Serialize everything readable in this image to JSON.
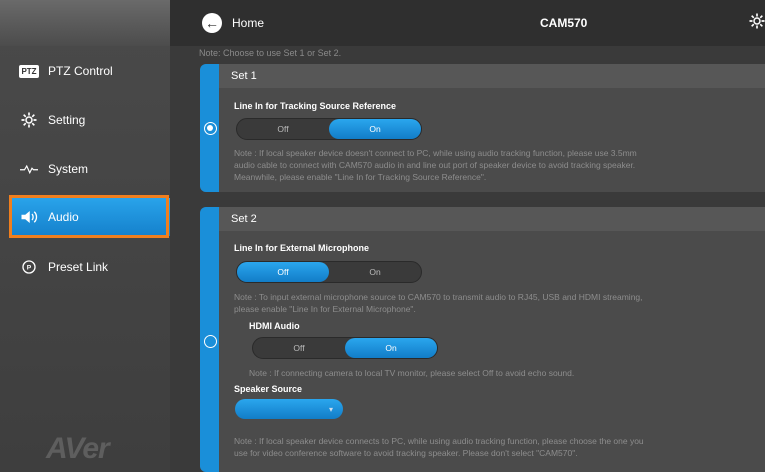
{
  "topbar": {
    "home_label": "Home",
    "camera_title": "CAM570"
  },
  "sidebar": {
    "items": [
      {
        "label": "PTZ Control",
        "icon": "ptz-icon"
      },
      {
        "label": "Setting",
        "icon": "gear-icon"
      },
      {
        "label": "System",
        "icon": "pulse-icon"
      },
      {
        "label": "Audio",
        "icon": "speaker-icon"
      },
      {
        "label": "Preset Link",
        "icon": "preset-icon"
      }
    ],
    "active": "Audio",
    "logo": "AVer"
  },
  "main": {
    "top_note": "Note: Choose to use Set 1 or Set 2.",
    "set1": {
      "title": "Set 1",
      "selected": true,
      "option_label": "Line In for Tracking Source Reference",
      "toggle": {
        "off": "Off",
        "on": "On",
        "value": "On"
      },
      "note_line1": "Note : If local speaker device doesn't connect to PC, while using audio tracking function, please use 3.5mm",
      "note_line2": "audio cable to connect with CAM570 audio in and line out port of speaker device to avoid tracking speaker.",
      "note_line3": "Meanwhile, please enable \"Line In for Tracking Source Reference\"."
    },
    "set2": {
      "title": "Set 2",
      "selected": false,
      "option_label": "Line In for External Microphone",
      "toggle": {
        "off": "Off",
        "on": "On",
        "value": "Off"
      },
      "note_line1": "Note : To input external microphone source to CAM570 to transmit audio to RJ45, USB and HDMI streaming,",
      "note_line2": "please enable \"Line In for External Microphone\".",
      "hdmi_label": "HDMI Audio",
      "hdmi_toggle": {
        "off": "Off",
        "on": "On",
        "value": "On"
      },
      "hdmi_note": "Note : If connecting camera to local TV monitor, please select Off to avoid echo sound.",
      "speaker_label": "Speaker Source",
      "speaker_note_line1": "Note : If local speaker device connects to PC, while using audio tracking function, please choose the one you",
      "speaker_note_line2": "use for video conference software to avoid tracking speaker. Please don't select \"CAM570\"."
    }
  },
  "colors": {
    "accent": "#1a8fd9",
    "highlight_outline": "#f07f1e"
  }
}
